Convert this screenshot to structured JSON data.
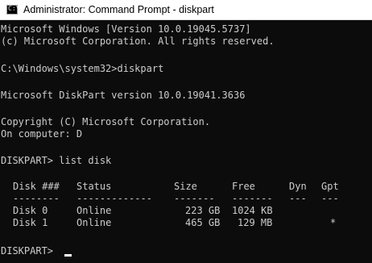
{
  "window": {
    "icon": "command-prompt-icon",
    "icon_glyph": "C:\\",
    "title": "Administrator: Command Prompt - diskpart"
  },
  "console": {
    "header_line_1": "Microsoft Windows [Version 10.0.19045.5737]",
    "header_line_2": "(c) Microsoft Corporation. All rights reserved.",
    "command_line": "C:\\Windows\\system32>diskpart",
    "diskpart_version": "Microsoft DiskPart version 10.0.19041.3636",
    "copyright": "Copyright (C) Microsoft Corporation.",
    "computer": "On computer: D",
    "list_command": "DISKPART> list disk",
    "prompt": "DISKPART> "
  },
  "disk_table": {
    "columns": [
      "Disk ###",
      "Status",
      "Size",
      "Free",
      "Dyn",
      "Gpt"
    ],
    "separators": [
      "--------",
      "-------------",
      "-------",
      "-------",
      "---",
      "---"
    ],
    "rows": [
      [
        "Disk 0",
        "Online",
        "223 GB",
        "1024 KB",
        "",
        ""
      ],
      [
        "Disk 1",
        "Online",
        "465 GB",
        "129 MB",
        "",
        "*"
      ]
    ]
  }
}
